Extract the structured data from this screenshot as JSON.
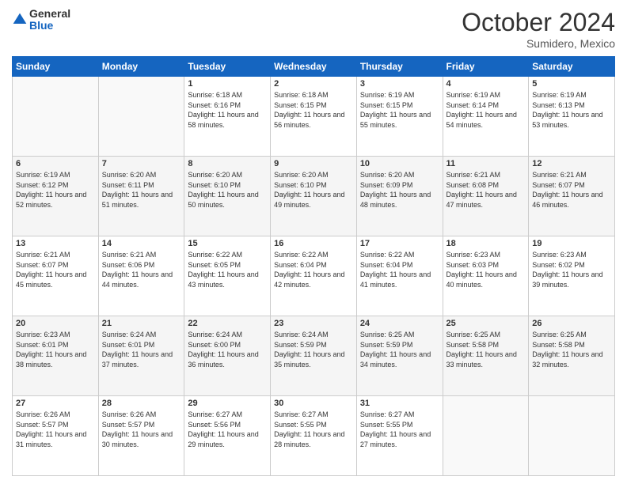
{
  "header": {
    "logo": {
      "line1": "General",
      "line2": "Blue"
    },
    "title": "October 2024",
    "location": "Sumidero, Mexico"
  },
  "days_of_week": [
    "Sunday",
    "Monday",
    "Tuesday",
    "Wednesday",
    "Thursday",
    "Friday",
    "Saturday"
  ],
  "weeks": [
    [
      {
        "day": "",
        "sunrise": "",
        "sunset": "",
        "daylight": ""
      },
      {
        "day": "",
        "sunrise": "",
        "sunset": "",
        "daylight": ""
      },
      {
        "day": "1",
        "sunrise": "Sunrise: 6:18 AM",
        "sunset": "Sunset: 6:16 PM",
        "daylight": "Daylight: 11 hours and 58 minutes."
      },
      {
        "day": "2",
        "sunrise": "Sunrise: 6:18 AM",
        "sunset": "Sunset: 6:15 PM",
        "daylight": "Daylight: 11 hours and 56 minutes."
      },
      {
        "day": "3",
        "sunrise": "Sunrise: 6:19 AM",
        "sunset": "Sunset: 6:15 PM",
        "daylight": "Daylight: 11 hours and 55 minutes."
      },
      {
        "day": "4",
        "sunrise": "Sunrise: 6:19 AM",
        "sunset": "Sunset: 6:14 PM",
        "daylight": "Daylight: 11 hours and 54 minutes."
      },
      {
        "day": "5",
        "sunrise": "Sunrise: 6:19 AM",
        "sunset": "Sunset: 6:13 PM",
        "daylight": "Daylight: 11 hours and 53 minutes."
      }
    ],
    [
      {
        "day": "6",
        "sunrise": "Sunrise: 6:19 AM",
        "sunset": "Sunset: 6:12 PM",
        "daylight": "Daylight: 11 hours and 52 minutes."
      },
      {
        "day": "7",
        "sunrise": "Sunrise: 6:20 AM",
        "sunset": "Sunset: 6:11 PM",
        "daylight": "Daylight: 11 hours and 51 minutes."
      },
      {
        "day": "8",
        "sunrise": "Sunrise: 6:20 AM",
        "sunset": "Sunset: 6:10 PM",
        "daylight": "Daylight: 11 hours and 50 minutes."
      },
      {
        "day": "9",
        "sunrise": "Sunrise: 6:20 AM",
        "sunset": "Sunset: 6:10 PM",
        "daylight": "Daylight: 11 hours and 49 minutes."
      },
      {
        "day": "10",
        "sunrise": "Sunrise: 6:20 AM",
        "sunset": "Sunset: 6:09 PM",
        "daylight": "Daylight: 11 hours and 48 minutes."
      },
      {
        "day": "11",
        "sunrise": "Sunrise: 6:21 AM",
        "sunset": "Sunset: 6:08 PM",
        "daylight": "Daylight: 11 hours and 47 minutes."
      },
      {
        "day": "12",
        "sunrise": "Sunrise: 6:21 AM",
        "sunset": "Sunset: 6:07 PM",
        "daylight": "Daylight: 11 hours and 46 minutes."
      }
    ],
    [
      {
        "day": "13",
        "sunrise": "Sunrise: 6:21 AM",
        "sunset": "Sunset: 6:07 PM",
        "daylight": "Daylight: 11 hours and 45 minutes."
      },
      {
        "day": "14",
        "sunrise": "Sunrise: 6:21 AM",
        "sunset": "Sunset: 6:06 PM",
        "daylight": "Daylight: 11 hours and 44 minutes."
      },
      {
        "day": "15",
        "sunrise": "Sunrise: 6:22 AM",
        "sunset": "Sunset: 6:05 PM",
        "daylight": "Daylight: 11 hours and 43 minutes."
      },
      {
        "day": "16",
        "sunrise": "Sunrise: 6:22 AM",
        "sunset": "Sunset: 6:04 PM",
        "daylight": "Daylight: 11 hours and 42 minutes."
      },
      {
        "day": "17",
        "sunrise": "Sunrise: 6:22 AM",
        "sunset": "Sunset: 6:04 PM",
        "daylight": "Daylight: 11 hours and 41 minutes."
      },
      {
        "day": "18",
        "sunrise": "Sunrise: 6:23 AM",
        "sunset": "Sunset: 6:03 PM",
        "daylight": "Daylight: 11 hours and 40 minutes."
      },
      {
        "day": "19",
        "sunrise": "Sunrise: 6:23 AM",
        "sunset": "Sunset: 6:02 PM",
        "daylight": "Daylight: 11 hours and 39 minutes."
      }
    ],
    [
      {
        "day": "20",
        "sunrise": "Sunrise: 6:23 AM",
        "sunset": "Sunset: 6:01 PM",
        "daylight": "Daylight: 11 hours and 38 minutes."
      },
      {
        "day": "21",
        "sunrise": "Sunrise: 6:24 AM",
        "sunset": "Sunset: 6:01 PM",
        "daylight": "Daylight: 11 hours and 37 minutes."
      },
      {
        "day": "22",
        "sunrise": "Sunrise: 6:24 AM",
        "sunset": "Sunset: 6:00 PM",
        "daylight": "Daylight: 11 hours and 36 minutes."
      },
      {
        "day": "23",
        "sunrise": "Sunrise: 6:24 AM",
        "sunset": "Sunset: 5:59 PM",
        "daylight": "Daylight: 11 hours and 35 minutes."
      },
      {
        "day": "24",
        "sunrise": "Sunrise: 6:25 AM",
        "sunset": "Sunset: 5:59 PM",
        "daylight": "Daylight: 11 hours and 34 minutes."
      },
      {
        "day": "25",
        "sunrise": "Sunrise: 6:25 AM",
        "sunset": "Sunset: 5:58 PM",
        "daylight": "Daylight: 11 hours and 33 minutes."
      },
      {
        "day": "26",
        "sunrise": "Sunrise: 6:25 AM",
        "sunset": "Sunset: 5:58 PM",
        "daylight": "Daylight: 11 hours and 32 minutes."
      }
    ],
    [
      {
        "day": "27",
        "sunrise": "Sunrise: 6:26 AM",
        "sunset": "Sunset: 5:57 PM",
        "daylight": "Daylight: 11 hours and 31 minutes."
      },
      {
        "day": "28",
        "sunrise": "Sunrise: 6:26 AM",
        "sunset": "Sunset: 5:57 PM",
        "daylight": "Daylight: 11 hours and 30 minutes."
      },
      {
        "day": "29",
        "sunrise": "Sunrise: 6:27 AM",
        "sunset": "Sunset: 5:56 PM",
        "daylight": "Daylight: 11 hours and 29 minutes."
      },
      {
        "day": "30",
        "sunrise": "Sunrise: 6:27 AM",
        "sunset": "Sunset: 5:55 PM",
        "daylight": "Daylight: 11 hours and 28 minutes."
      },
      {
        "day": "31",
        "sunrise": "Sunrise: 6:27 AM",
        "sunset": "Sunset: 5:55 PM",
        "daylight": "Daylight: 11 hours and 27 minutes."
      },
      {
        "day": "",
        "sunrise": "",
        "sunset": "",
        "daylight": ""
      },
      {
        "day": "",
        "sunrise": "",
        "sunset": "",
        "daylight": ""
      }
    ]
  ]
}
